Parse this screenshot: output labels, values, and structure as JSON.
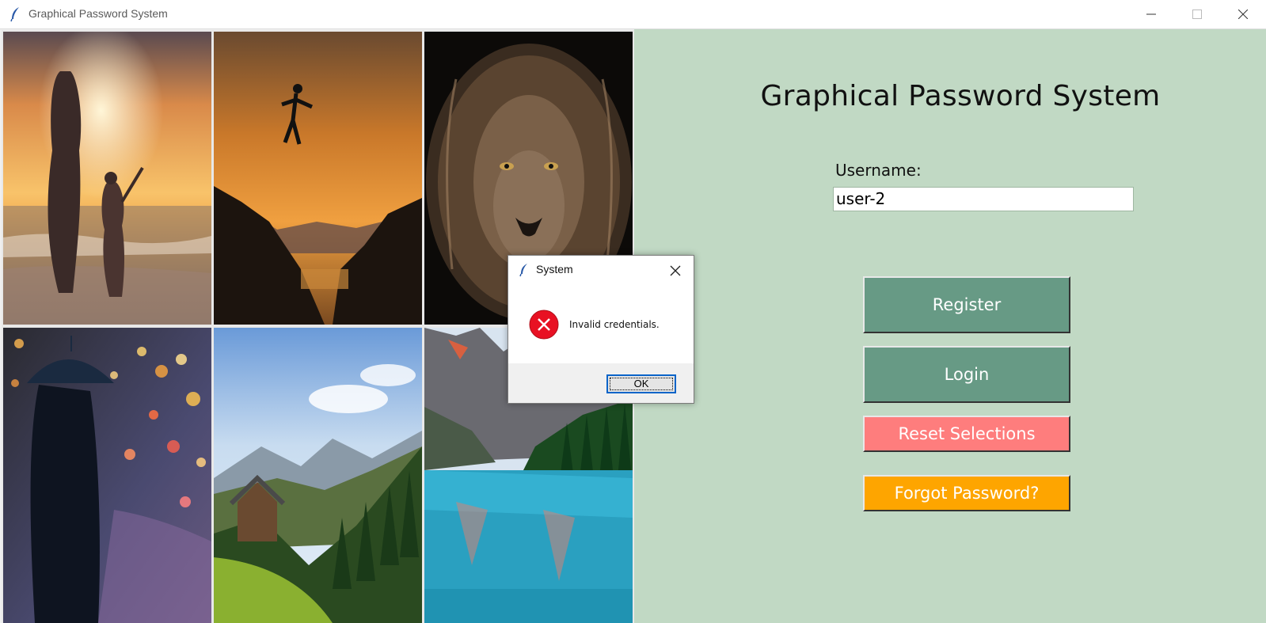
{
  "window": {
    "title": "Graphical Password System",
    "icon": "feather-icon"
  },
  "images": [
    {
      "name": "beach-sunset-mother-child-image"
    },
    {
      "name": "jumping-person-sunset-image"
    },
    {
      "name": "lion-portrait-image"
    },
    {
      "name": "umbrella-rainy-night-image"
    },
    {
      "name": "mountain-cabin-valley-image"
    },
    {
      "name": "mountain-lake-image"
    }
  ],
  "panel": {
    "title": "Graphical Password System",
    "username_label": "Username:",
    "username_value": "user-2",
    "buttons": {
      "register": "Register",
      "login": "Login",
      "reset": "Reset Selections",
      "forgot": "Forgot Password?"
    },
    "colors": {
      "background": "#c1d9c4",
      "register": "#679a85",
      "login": "#679a85",
      "reset": "#fe7d7d",
      "forgot": "#fea500"
    }
  },
  "dialog": {
    "title": "System",
    "message": "Invalid credentials.",
    "ok_label": "OK",
    "icon": "error-icon",
    "icon_color": "#e81123"
  }
}
